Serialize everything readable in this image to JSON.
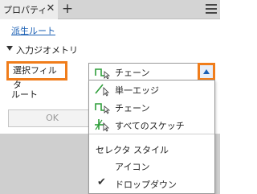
{
  "tab": {
    "title": "プロパティ",
    "close": "✕",
    "add": "+"
  },
  "link": {
    "label": "派生ルート"
  },
  "section": {
    "title": "入力ジオメトリ"
  },
  "fields": {
    "select_filter_label": "選択フィルタ",
    "route_label": "ルート",
    "selected_value": "チェーン"
  },
  "button": {
    "ok": "OK"
  },
  "dropdown": {
    "filters": [
      {
        "label": "単一エッジ",
        "icon": "single-edge-icon"
      },
      {
        "label": "チェーン",
        "icon": "chain-icon"
      },
      {
        "label": "すべてのスケッチ",
        "icon": "all-sketches-icon"
      }
    ],
    "selector_style_heading": "セレクタ スタイル",
    "styles": [
      {
        "label": "アイコン",
        "checked": false
      },
      {
        "label": "ドロップダウン",
        "checked": true
      }
    ],
    "check_mark": "✔"
  },
  "colors": {
    "highlight": "#f07d1b",
    "link": "#1a5fb4",
    "icon_green": "#2e9e3a"
  }
}
